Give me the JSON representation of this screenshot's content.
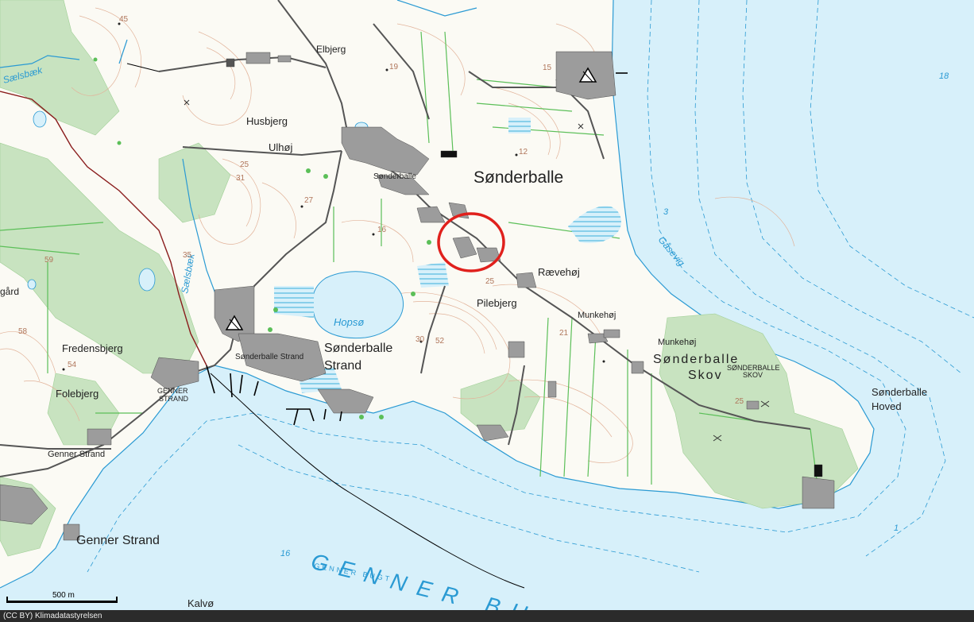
{
  "map": {
    "labels": {
      "elbjerg": "Elbjerg",
      "husbjerg": "Husbjerg",
      "ulhoj": "Ulhøj",
      "sonderballe_small": "Sønderballe",
      "sonderballe": "Sønderballe",
      "raevehoj": "Rævehøj",
      "pilebjerg": "Pilebjerg",
      "munkehoj1": "Munkehøj",
      "munkehoj2": "Munkehøj",
      "sonderballe_skov_1": "Sønderballe",
      "sonderballe_skov_2": "Skov",
      "sonderballe_skov_small_1": "SØNDERBALLE",
      "sonderballe_skov_small_2": "SKOV",
      "sonderballe_hoved_1": "Sønderballe",
      "sonderballe_hoved_2": "Hoved",
      "hopso": "Hopsø",
      "sonderballe_strand_1": "Sønderballe",
      "sonderballe_strand_2": "Strand",
      "sonderballe_strand_small": "Sønderballe Strand",
      "fredensbjerg": "Fredensbjerg",
      "folebjerg": "Folebjerg",
      "genner_strand_small_1": "GENNER",
      "genner_strand_small_2": "STRAND",
      "genner_strand_road": "Genner Strand",
      "genner_strand": "Genner Strand",
      "kalvo": "Kalvø",
      "gard": "gård",
      "saelsbaek1": "Sælsbæk",
      "saelsbaek2": "Sælsbæk",
      "gasevig": "Gåsevig",
      "genner_bugt_big": "GENNER BUG",
      "genner_bugt_small": "GENNER BUGT"
    },
    "depths": [
      "18",
      "3",
      "16",
      "1"
    ],
    "contour_numbers": [
      "45",
      "19",
      "15",
      "12",
      "25",
      "31",
      "27",
      "16",
      "25",
      "59",
      "35",
      "58",
      "54",
      "30",
      "52",
      "21",
      "25"
    ],
    "colors": {
      "land": "#fbfaf4",
      "sea": "#d7f0fa",
      "forest": "#c8e3c0",
      "road": "#555555",
      "building": "#9c9c9c",
      "water_line": "#2a9ad3",
      "contour": "#e2b39a",
      "field_border": "#5bbf58",
      "highlight_circle": "#e0201c"
    },
    "highlight": "red-circle-marker"
  },
  "scalebar": {
    "label": "500 m"
  },
  "footer": {
    "attribution": "(CC BY) Klimadatastyrelsen"
  }
}
